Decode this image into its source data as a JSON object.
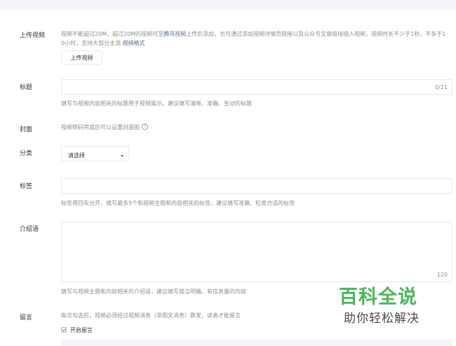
{
  "upload": {
    "label": "上传视频",
    "hint_part1": "视频不能超过20M，超过20M的视频可至",
    "hint_link1": "腾讯视频",
    "hint_part2": "上传后添加，也可通过添加视频详情页链接以及公众号文章链接插入视频，视频时长不少于1秒，不多于1",
    "hint_part3": "0小时，支持大部分主流 ",
    "hint_link2": "视频格式",
    "button_label": "上传视频"
  },
  "title": {
    "label": "标题",
    "counter": "0/21",
    "hint": "填写与视频内容相关的标题用于视频展示，建议填写清晰、准确、生动的标题"
  },
  "cover": {
    "label": "封面",
    "hint": "视频转码完成后可以设置封面图",
    "help_icon": "?"
  },
  "category": {
    "label": "分类",
    "selected": "请选择"
  },
  "tags": {
    "label": "标签",
    "hint": "标签用回车分开，填写最多5个和视频主题和内容相关的标签，建议填写准确、粒度合适的标签"
  },
  "intro": {
    "label": "介绍语",
    "counter": "120",
    "hint": "填写与视频主题和内容相关的介绍语，建议填写简洁明确、有信息量的内容"
  },
  "comment": {
    "label": "留言",
    "hint": "每次勾选后，视频必须经过视频消息（非图文消息）群发，读者才能留言",
    "checkbox_label": "开启留言",
    "checked": true
  },
  "watermark": {
    "title": "百科全说",
    "subtitle": "助你轻松解决"
  },
  "colors": {
    "link": "#576b95",
    "border": "#e4e8eb",
    "hint_text": "#8d8d8d",
    "check": "#1aad19",
    "watermark_green": "#4ab858"
  }
}
